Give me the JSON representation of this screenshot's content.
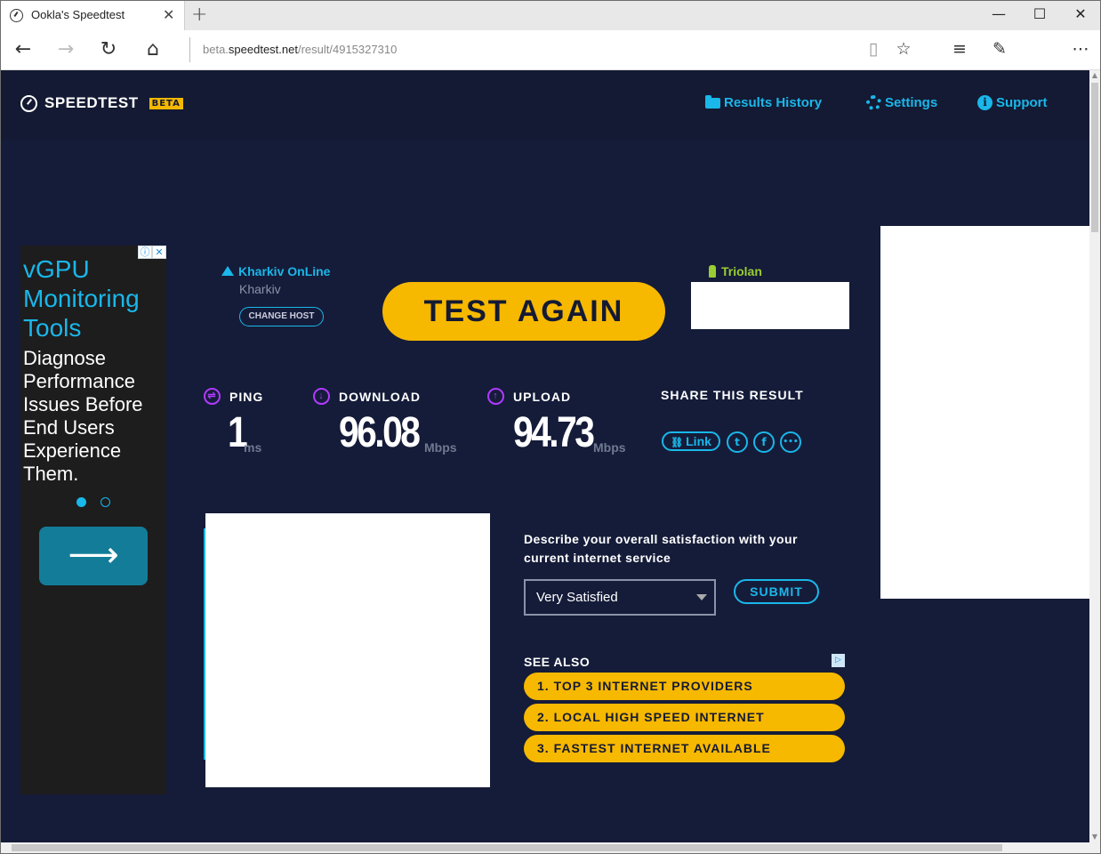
{
  "browser": {
    "tab_title": "Ookla's Speedtest",
    "tab_close": "✕",
    "new_tab": "+",
    "url_prefix": "beta.",
    "url_host": "speedtest.net",
    "url_path": "/result/4915327310",
    "window": {
      "minimize": "—",
      "maximize": "☐",
      "close": "✕"
    },
    "nav": {
      "back": "←",
      "forward": "→",
      "refresh": "↻",
      "home": "⌂"
    },
    "tools": {
      "reading": "📖",
      "favorite": "☆",
      "hub": "≡",
      "notes": "✎",
      "more": "⋯"
    }
  },
  "header": {
    "logo_text": "SPEEDTEST",
    "logo_badge": "BETA",
    "nav": [
      {
        "label": "Results History",
        "icon": "folder-icon"
      },
      {
        "label": "Settings",
        "icon": "gear-icon"
      },
      {
        "label": "Support",
        "icon": "info-icon"
      }
    ]
  },
  "ad": {
    "heading": "vGPU Monitoring Tools",
    "body": "Diagnose Performance Issues Before End Users Experience Them.",
    "info_icon": "ⓘ",
    "close_icon": "✕",
    "arrow": "⟶"
  },
  "server": {
    "isp_name": "Kharkiv OnLine",
    "city": "Kharkiv",
    "change_host": "CHANGE HOST",
    "provider": "Triolan"
  },
  "test_again": "TEST AGAIN",
  "results": {
    "ping": {
      "label": "PING",
      "value": "1",
      "unit": "ms",
      "icon": "⇌"
    },
    "download": {
      "label": "DOWNLOAD",
      "value": "96.08",
      "unit": "Mbps",
      "icon": "↓"
    },
    "upload": {
      "label": "UPLOAD",
      "value": "94.73",
      "unit": "Mbps",
      "icon": "↑"
    }
  },
  "share": {
    "title": "SHARE THIS RESULT",
    "link_label": "Link",
    "twitter": "t",
    "facebook": "f",
    "more": "•••"
  },
  "satisfaction": {
    "question": "Describe your overall satisfaction with your current internet service",
    "selected": "Very Satisfied",
    "submit": "SUBMIT"
  },
  "see_also": {
    "title": "SEE ALSO",
    "items": [
      "1.  TOP 3 INTERNET PROVIDERS",
      "2.  LOCAL HIGH SPEED INTERNET",
      "3.  FASTEST INTERNET AVAILABLE"
    ]
  },
  "colors": {
    "page_bg": "#141a33",
    "accent": "#1ab7ea",
    "button_yellow": "#f7b800",
    "metric_icon": "#b03aff",
    "provider_green": "#9acd32"
  }
}
